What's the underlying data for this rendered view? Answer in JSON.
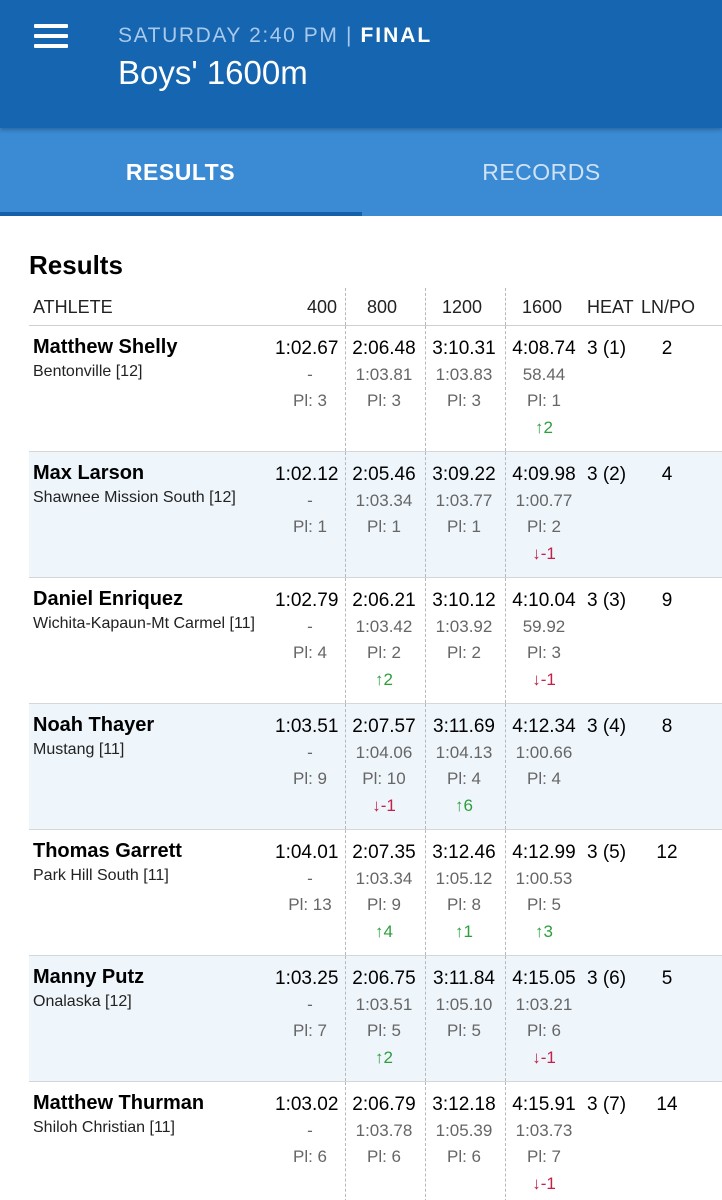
{
  "header": {
    "day_time": "SATURDAY 2:40 PM",
    "separator": "|",
    "status": "FINAL",
    "title": "Boys' 1600m"
  },
  "tabs": [
    {
      "label": "RESULTS",
      "active": true
    },
    {
      "label": "RECORDS",
      "active": false
    }
  ],
  "section_title": "Results",
  "columns": {
    "athlete": "ATHLETE",
    "s400": "400",
    "s800": "800",
    "s1200": "1200",
    "s1600": "1600",
    "heat": "HEAT",
    "lnpo": "LN/PO"
  },
  "rows": [
    {
      "name": "Matthew Shelly",
      "school": "Bentonville [12]",
      "s400": {
        "time": "1:02.67",
        "split": "-",
        "place": "Pl: 3",
        "move": "",
        "dir": ""
      },
      "s800": {
        "time": "2:06.48",
        "split": "1:03.81",
        "place": "Pl: 3",
        "move": "",
        "dir": ""
      },
      "s1200": {
        "time": "3:10.31",
        "split": "1:03.83",
        "place": "Pl: 3",
        "move": "",
        "dir": ""
      },
      "s1600": {
        "time": "4:08.74",
        "split": "58.44",
        "place": "Pl: 1",
        "move": "↑2",
        "dir": "up"
      },
      "heat": "3 (1)",
      "lane": "2"
    },
    {
      "name": "Max Larson",
      "school": "Shawnee Mission South [12]",
      "s400": {
        "time": "1:02.12",
        "split": "-",
        "place": "Pl: 1",
        "move": "",
        "dir": ""
      },
      "s800": {
        "time": "2:05.46",
        "split": "1:03.34",
        "place": "Pl: 1",
        "move": "",
        "dir": ""
      },
      "s1200": {
        "time": "3:09.22",
        "split": "1:03.77",
        "place": "Pl: 1",
        "move": "",
        "dir": ""
      },
      "s1600": {
        "time": "4:09.98",
        "split": "1:00.77",
        "place": "Pl: 2",
        "move": "↓-1",
        "dir": "down"
      },
      "heat": "3 (2)",
      "lane": "4"
    },
    {
      "name": "Daniel Enriquez",
      "school": "Wichita-Kapaun-Mt Carmel [11]",
      "s400": {
        "time": "1:02.79",
        "split": "-",
        "place": "Pl: 4",
        "move": "",
        "dir": ""
      },
      "s800": {
        "time": "2:06.21",
        "split": "1:03.42",
        "place": "Pl: 2",
        "move": "↑2",
        "dir": "up"
      },
      "s1200": {
        "time": "3:10.12",
        "split": "1:03.92",
        "place": "Pl: 2",
        "move": "",
        "dir": ""
      },
      "s1600": {
        "time": "4:10.04",
        "split": "59.92",
        "place": "Pl: 3",
        "move": "↓-1",
        "dir": "down"
      },
      "heat": "3 (3)",
      "lane": "9"
    },
    {
      "name": "Noah Thayer",
      "school": "Mustang [11]",
      "s400": {
        "time": "1:03.51",
        "split": "-",
        "place": "Pl: 9",
        "move": "",
        "dir": ""
      },
      "s800": {
        "time": "2:07.57",
        "split": "1:04.06",
        "place": "Pl: 10",
        "move": "↓-1",
        "dir": "down"
      },
      "s1200": {
        "time": "3:11.69",
        "split": "1:04.13",
        "place": "Pl: 4",
        "move": "↑6",
        "dir": "up"
      },
      "s1600": {
        "time": "4:12.34",
        "split": "1:00.66",
        "place": "Pl: 4",
        "move": "",
        "dir": ""
      },
      "heat": "3 (4)",
      "lane": "8"
    },
    {
      "name": "Thomas Garrett",
      "school": "Park Hill South [11]",
      "s400": {
        "time": "1:04.01",
        "split": "-",
        "place": "Pl: 13",
        "move": "",
        "dir": ""
      },
      "s800": {
        "time": "2:07.35",
        "split": "1:03.34",
        "place": "Pl: 9",
        "move": "↑4",
        "dir": "up"
      },
      "s1200": {
        "time": "3:12.46",
        "split": "1:05.12",
        "place": "Pl: 8",
        "move": "↑1",
        "dir": "up"
      },
      "s1600": {
        "time": "4:12.99",
        "split": "1:00.53",
        "place": "Pl: 5",
        "move": "↑3",
        "dir": "up"
      },
      "heat": "3 (5)",
      "lane": "12"
    },
    {
      "name": "Manny Putz",
      "school": "Onalaska [12]",
      "s400": {
        "time": "1:03.25",
        "split": "-",
        "place": "Pl: 7",
        "move": "",
        "dir": ""
      },
      "s800": {
        "time": "2:06.75",
        "split": "1:03.51",
        "place": "Pl: 5",
        "move": "↑2",
        "dir": "up"
      },
      "s1200": {
        "time": "3:11.84",
        "split": "1:05.10",
        "place": "Pl: 5",
        "move": "",
        "dir": ""
      },
      "s1600": {
        "time": "4:15.05",
        "split": "1:03.21",
        "place": "Pl: 6",
        "move": "↓-1",
        "dir": "down"
      },
      "heat": "3 (6)",
      "lane": "5"
    },
    {
      "name": "Matthew Thurman",
      "school": "Shiloh Christian [11]",
      "s400": {
        "time": "1:03.02",
        "split": "-",
        "place": "Pl: 6",
        "move": "",
        "dir": ""
      },
      "s800": {
        "time": "2:06.79",
        "split": "1:03.78",
        "place": "Pl: 6",
        "move": "",
        "dir": ""
      },
      "s1200": {
        "time": "3:12.18",
        "split": "1:05.39",
        "place": "Pl: 6",
        "move": "",
        "dir": ""
      },
      "s1600": {
        "time": "4:15.91",
        "split": "1:03.73",
        "place": "Pl: 7",
        "move": "↓-1",
        "dir": "down"
      },
      "heat": "3 (7)",
      "lane": "14"
    }
  ]
}
